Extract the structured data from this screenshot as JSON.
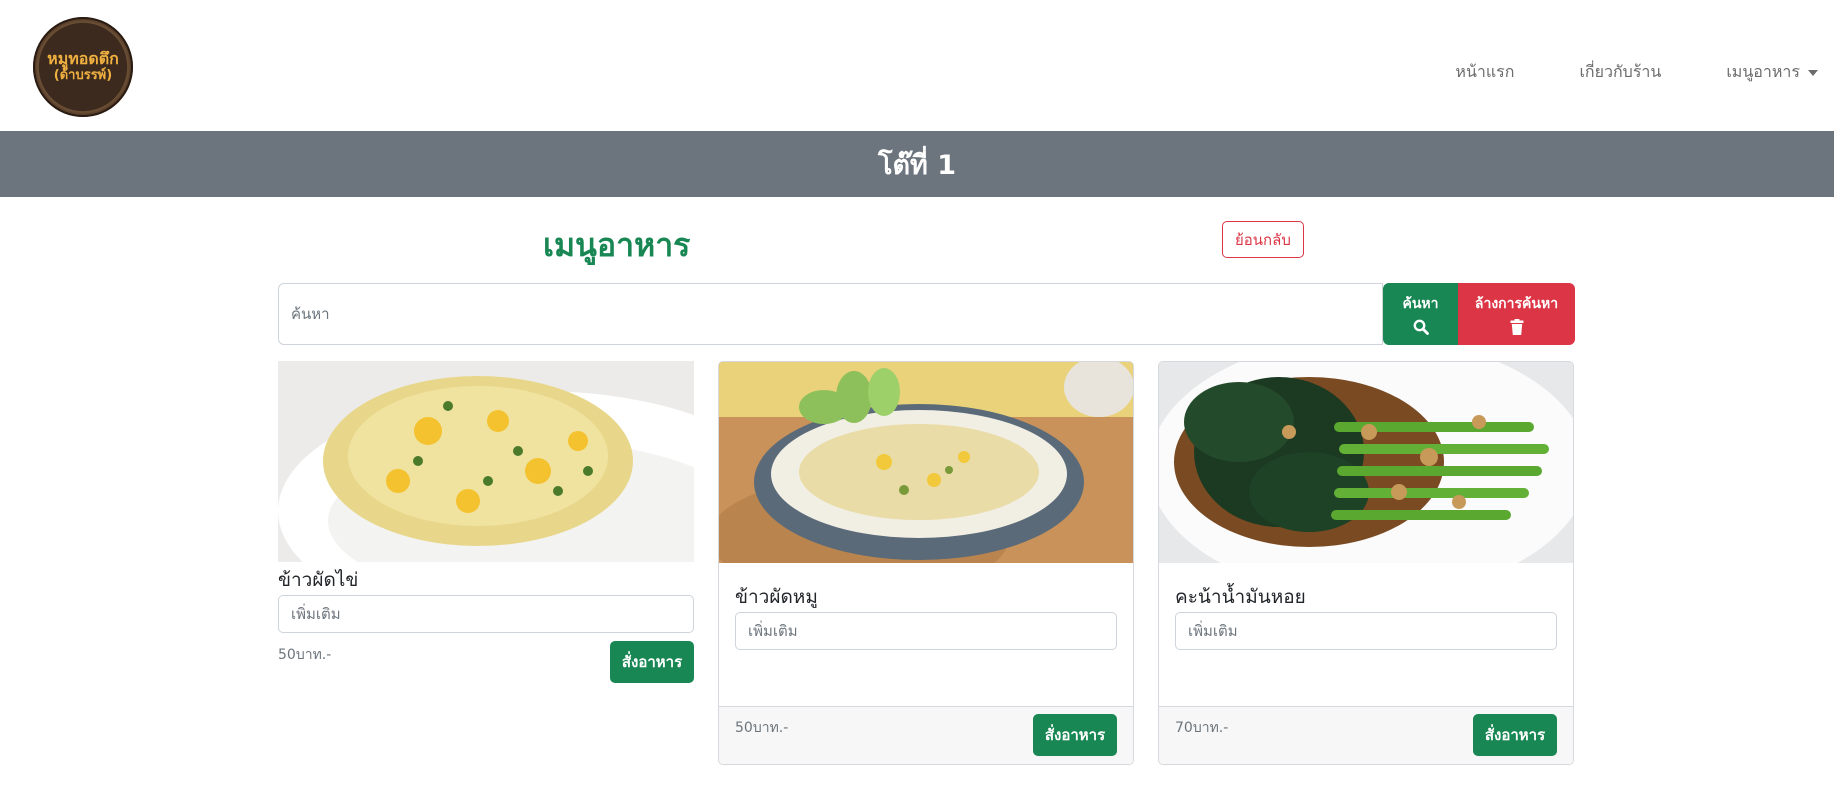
{
  "brand": {
    "logo_line1": "หมูทอดตึก",
    "logo_line2": "(ด้าบรรพ์)"
  },
  "nav": {
    "home": "หน้าแรก",
    "about": "เกี่ยวกับร้าน",
    "menu": "เมนูอาหาร"
  },
  "banner": {
    "table_label": "โต๊ที่ 1"
  },
  "page": {
    "menu_title": "เมนูอาหาร",
    "back_label": "ย้อนกลับ"
  },
  "search": {
    "placeholder": "ค้นหา",
    "value": "",
    "search_label": "ค้นหา",
    "clear_label": "ล้างการค้นหา"
  },
  "menu_items": [
    {
      "name": "ข้าวผัดไข่",
      "note_placeholder": "เพิ่มเติม",
      "price": "50บาท.-",
      "order_label": "สั่งอาหาร"
    },
    {
      "name": "ข้าวผัดหมู",
      "note_placeholder": "เพิ่มเติม",
      "price": "50บาท.-",
      "order_label": "สั่งอาหาร"
    },
    {
      "name": "คะน้าน้ำมันหอย",
      "note_placeholder": "เพิ่มเติม",
      "price": "70บาท.-",
      "order_label": "สั่งอาหาร"
    }
  ],
  "colors": {
    "primary_green": "#198754",
    "danger_red": "#dc3545",
    "banner_gray": "#6c757d"
  }
}
